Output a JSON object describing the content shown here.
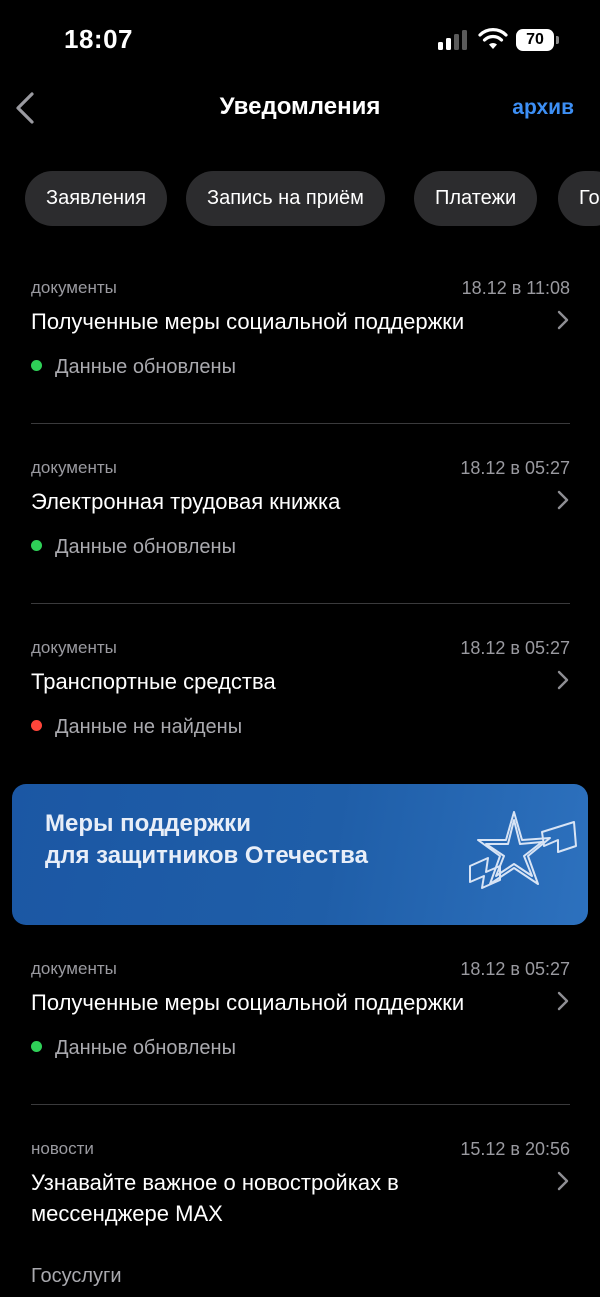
{
  "status_bar": {
    "time": "18:07",
    "battery": "70"
  },
  "nav": {
    "title": "Уведомления",
    "archive_label": "архив"
  },
  "chips": [
    "Заявления",
    "Запись на приём",
    "Платежи",
    "Го"
  ],
  "notifications": [
    {
      "category": "документы",
      "time": "18.12 в 11:08",
      "title": "Полученные меры социальной поддержки",
      "status": "Данные обновлены",
      "status_color": "#2fd158"
    },
    {
      "category": "документы",
      "time": "18.12 в 05:27",
      "title": "Электронная трудовая книжка",
      "status": "Данные обновлены",
      "status_color": "#2fd158"
    },
    {
      "category": "документы",
      "time": "18.12 в 05:27",
      "title": "Транспортные средства",
      "status": "Данные не найдены",
      "status_color": "#ff453a"
    },
    {
      "category": "документы",
      "time": "18.12 в 05:27",
      "title": "Полученные меры социальной поддержки",
      "status": "Данные обновлены",
      "status_color": "#2fd158"
    },
    {
      "category": "новости",
      "time": "15.12 в 20:56",
      "title": "Узнавайте важное о новостройках в мессенджере MAX",
      "source": "Госуслуги"
    }
  ],
  "banner": {
    "line1": "Меры поддержки",
    "line2": "для защитников Отечества"
  },
  "colors": {
    "accent": "#3d8ff5",
    "background": "#000000",
    "chip": "#2c2c2e",
    "banner": "#1f5ea8"
  }
}
